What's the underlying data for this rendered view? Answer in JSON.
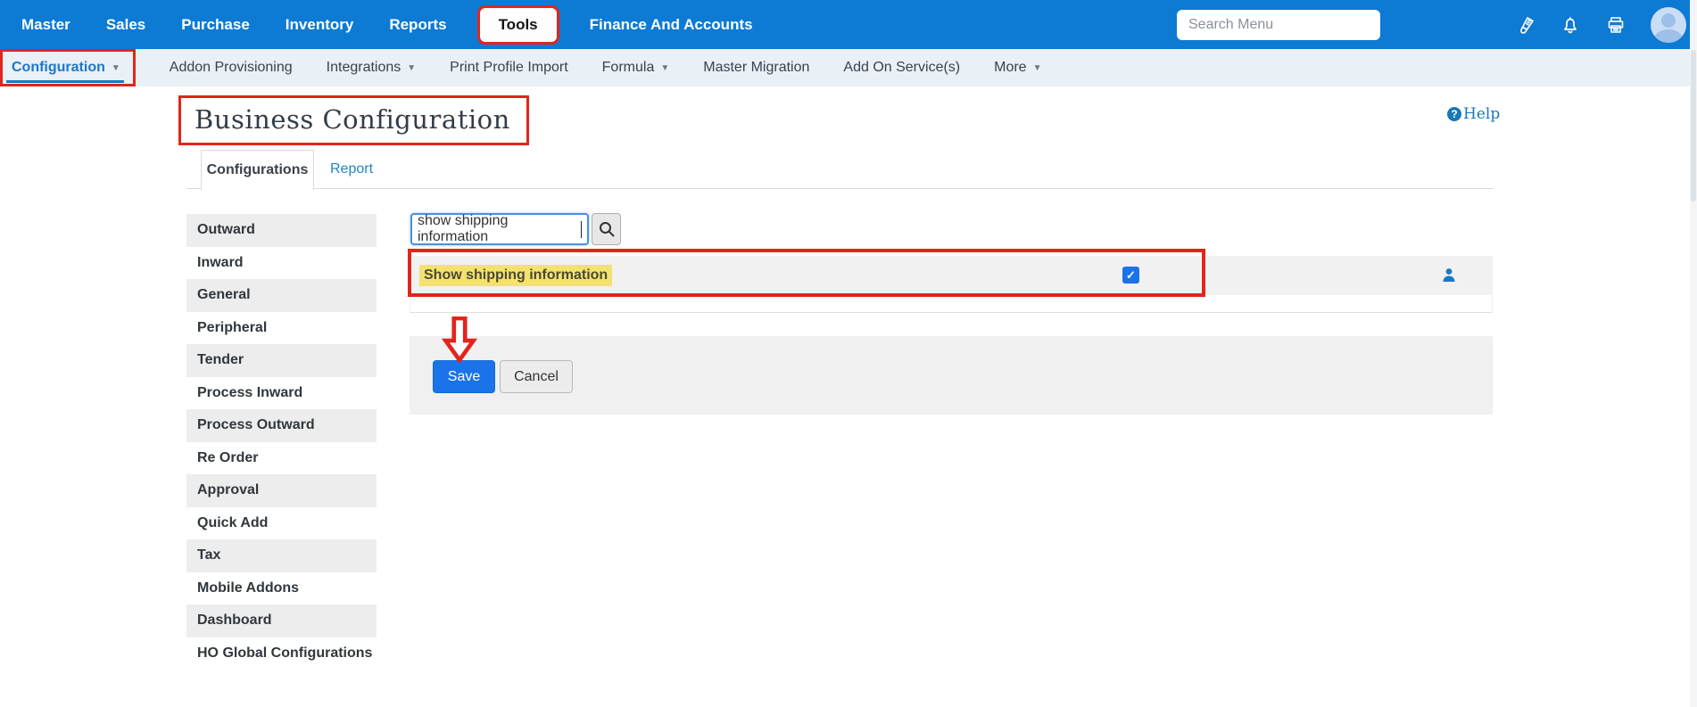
{
  "topnav": {
    "items": [
      {
        "label": "Master"
      },
      {
        "label": "Sales"
      },
      {
        "label": "Purchase"
      },
      {
        "label": "Inventory"
      },
      {
        "label": "Reports"
      },
      {
        "label": "Tools",
        "highlighted": true
      },
      {
        "label": "Finance And Accounts"
      }
    ],
    "search_placeholder": "Search Menu"
  },
  "subnav": {
    "items": [
      {
        "label": "Configuration",
        "has_caret": true,
        "active": true
      },
      {
        "label": "Addon Provisioning"
      },
      {
        "label": "Integrations",
        "has_caret": true
      },
      {
        "label": "Print Profile Import"
      },
      {
        "label": "Formula",
        "has_caret": true
      },
      {
        "label": "Master Migration"
      },
      {
        "label": "Add On Service(s)"
      },
      {
        "label": "More",
        "has_caret": true
      }
    ]
  },
  "page": {
    "title": "Business Configuration",
    "help_label": "Help"
  },
  "tabs": [
    {
      "label": "Configurations",
      "active": true
    },
    {
      "label": "Report",
      "active": false
    }
  ],
  "sidebar": {
    "items": [
      "Outward",
      "Inward",
      "General",
      "Peripheral",
      "Tender",
      "Process Inward",
      "Process Outward",
      "Re Order",
      "Approval",
      "Quick Add",
      "Tax",
      "Mobile Addons",
      "Dashboard",
      "HO Global Configurations"
    ]
  },
  "main": {
    "search_value": "show shipping information",
    "row": {
      "label": "Show shipping information",
      "checkbox_checked": true
    },
    "save_label": "Save",
    "cancel_label": "Cancel"
  },
  "icons": {
    "check": "✓",
    "caret": "▼",
    "question": "?"
  },
  "colors": {
    "topbar_blue": "#0d7ad4",
    "annotation_red": "#e1251c",
    "highlight_yellow": "#f3e173",
    "primary_button_blue": "#1a73e8",
    "link_blue": "#2086c8",
    "active_nav_blue": "#1b78c9",
    "help_blue": "#1878b4"
  }
}
